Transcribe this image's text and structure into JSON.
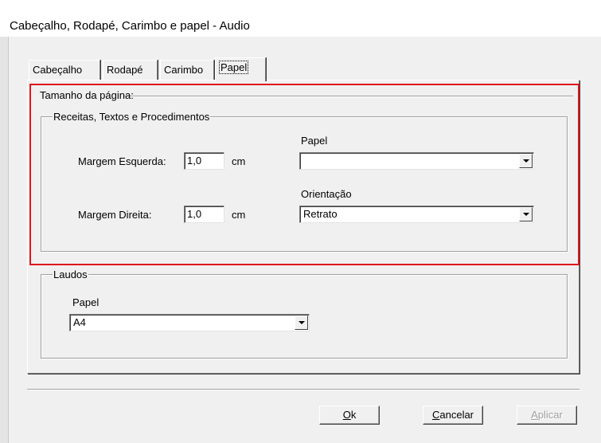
{
  "window": {
    "title": "Cabeçalho, Rodapé, Carimbo e papel - Audio"
  },
  "tabs": [
    {
      "label": "Cabeçalho",
      "active": false
    },
    {
      "label": "Rodapé",
      "active": false
    },
    {
      "label": "Carimbo",
      "active": false
    },
    {
      "label": "Papel",
      "active": true
    }
  ],
  "page_size": {
    "title": "Tamanho da página:",
    "receitas": {
      "title": "Receitas, Textos e Procedimentos",
      "margem_esquerda": {
        "label": "Margem Esquerda:",
        "value": "1,0",
        "unit": "cm"
      },
      "margem_direita": {
        "label": "Margem Direita:",
        "value": "1,0",
        "unit": "cm"
      },
      "papel": {
        "label": "Papel",
        "value": ""
      },
      "orientacao": {
        "label": "Orientação",
        "value": "Retrato"
      }
    },
    "laudos": {
      "title": "Laudos",
      "papel": {
        "label": "Papel",
        "value": "A4"
      }
    }
  },
  "buttons": {
    "ok": {
      "mnemonic": "O",
      "rest": "k"
    },
    "cancelar": {
      "mnemonic": "C",
      "rest": "ancelar"
    },
    "aplicar": {
      "mnemonic": "A",
      "rest": "plicar",
      "disabled": true
    }
  },
  "colors": {
    "highlight": "#e0161c",
    "dialog_bg": "#f0f0f0"
  }
}
